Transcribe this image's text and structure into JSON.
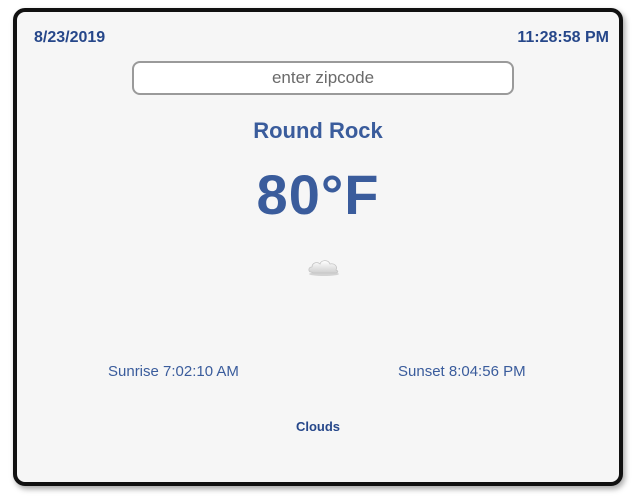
{
  "header": {
    "date": "8/23/2019",
    "time": "11:28:58 PM"
  },
  "search": {
    "placeholder": "enter zipcode",
    "value": ""
  },
  "weather": {
    "city": "Round Rock",
    "temperature": "80°F",
    "condition_icon": "cloud-icon",
    "sunrise": "Sunrise 7:02:10 AM",
    "sunset": "Sunset 8:04:56 PM",
    "conditions": "Clouds"
  },
  "colors": {
    "text_primary": "#3a5c9c",
    "text_dark": "#26478a",
    "background": "#f6f6f6",
    "frame": "#111111"
  }
}
